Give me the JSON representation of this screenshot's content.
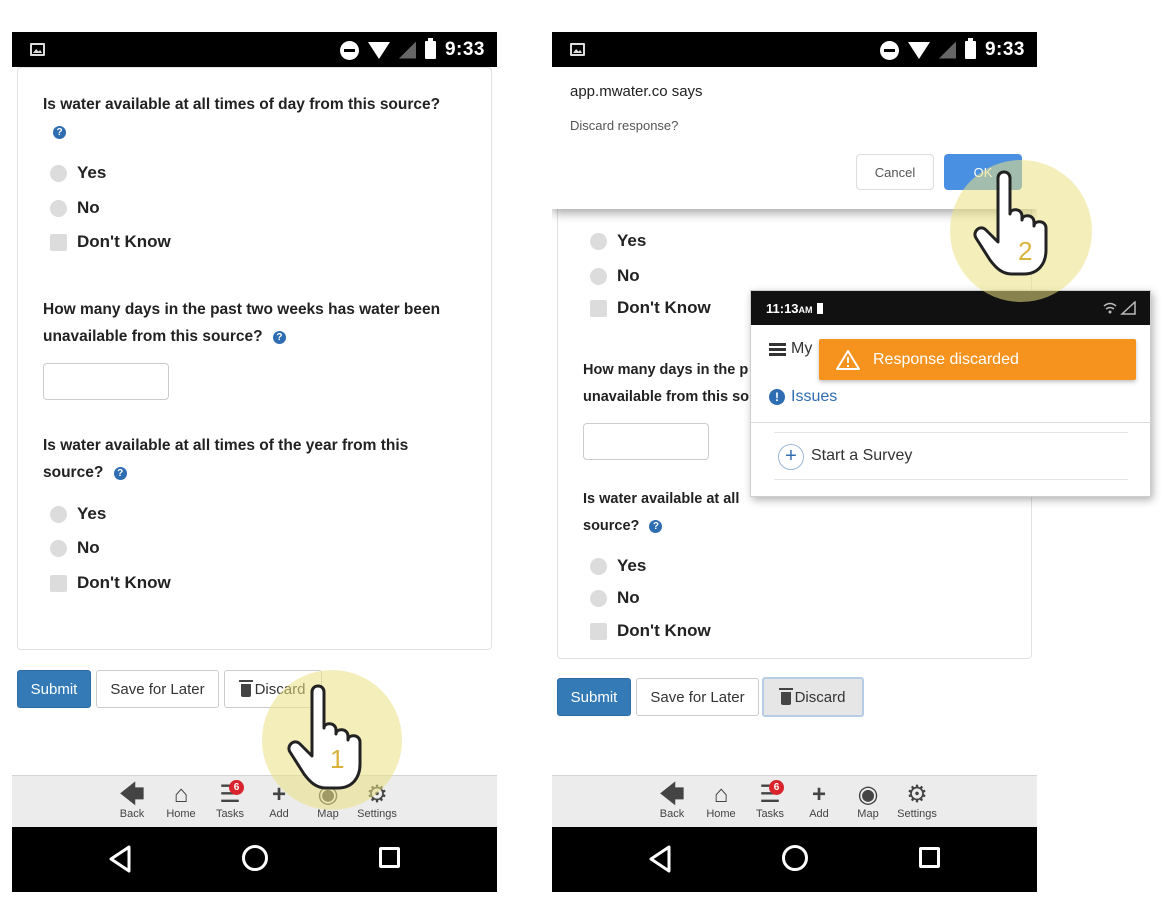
{
  "status_bar": {
    "time": "9:33"
  },
  "left_screen": {
    "questions": [
      {
        "text": "Is water available at all times of day from this source?",
        "options": [
          "Yes",
          "No",
          "Don't Know"
        ]
      },
      {
        "text": "How many days in the past two weeks has water been unavailable from this source?"
      },
      {
        "text": "Is water available at all times of the year from this source?",
        "options": [
          "Yes",
          "No",
          "Don't Know"
        ]
      }
    ],
    "buttons": {
      "submit": "Submit",
      "save_later": "Save for Later",
      "discard": "Discard"
    },
    "step_number": "1"
  },
  "right_screen": {
    "dialog": {
      "title": "app.mwater.co says",
      "message": "Discard response?",
      "cancel": "Cancel",
      "ok": "OK"
    },
    "partial_option_yes": "Yes",
    "options_a": [
      "No",
      "Don't Know"
    ],
    "question_2": [
      "How many days in the p",
      "unavailable from this so"
    ],
    "question_3": [
      "Is water available at all",
      "source?"
    ],
    "options_b": [
      "Yes",
      "No",
      "Don't Know"
    ],
    "buttons": {
      "submit": "Submit",
      "save_later": "Save for Later",
      "discard": "Discard"
    },
    "step_number": "2"
  },
  "bottom_nav": {
    "items": [
      "Back",
      "Home",
      "Tasks",
      "Add",
      "Map",
      "Settings"
    ],
    "tasks_badge": "6"
  },
  "popup": {
    "time": "11:13",
    "time_suffix": "AM",
    "my_label": "My",
    "toast": "Response discarded",
    "issues": "Issues",
    "start_survey": "Start a Survey"
  },
  "colors": {
    "primary_button": "#337ab7",
    "help_icon": "#2f6db2",
    "toast": "#f6921e",
    "ok_button": "#4a90e2",
    "badge": "#d9232d"
  },
  "icons": [
    "image-icon",
    "dnd-icon",
    "wifi-icon",
    "no-signal-icon",
    "battery-icon",
    "help-icon",
    "trash-icon",
    "back-arrow-icon",
    "home-icon",
    "tasks-icon",
    "add-icon",
    "map-pin-icon",
    "gear-icon",
    "list-icon",
    "warning-icon",
    "info-icon",
    "plus-circle-icon",
    "hand-pointer-icon"
  ]
}
